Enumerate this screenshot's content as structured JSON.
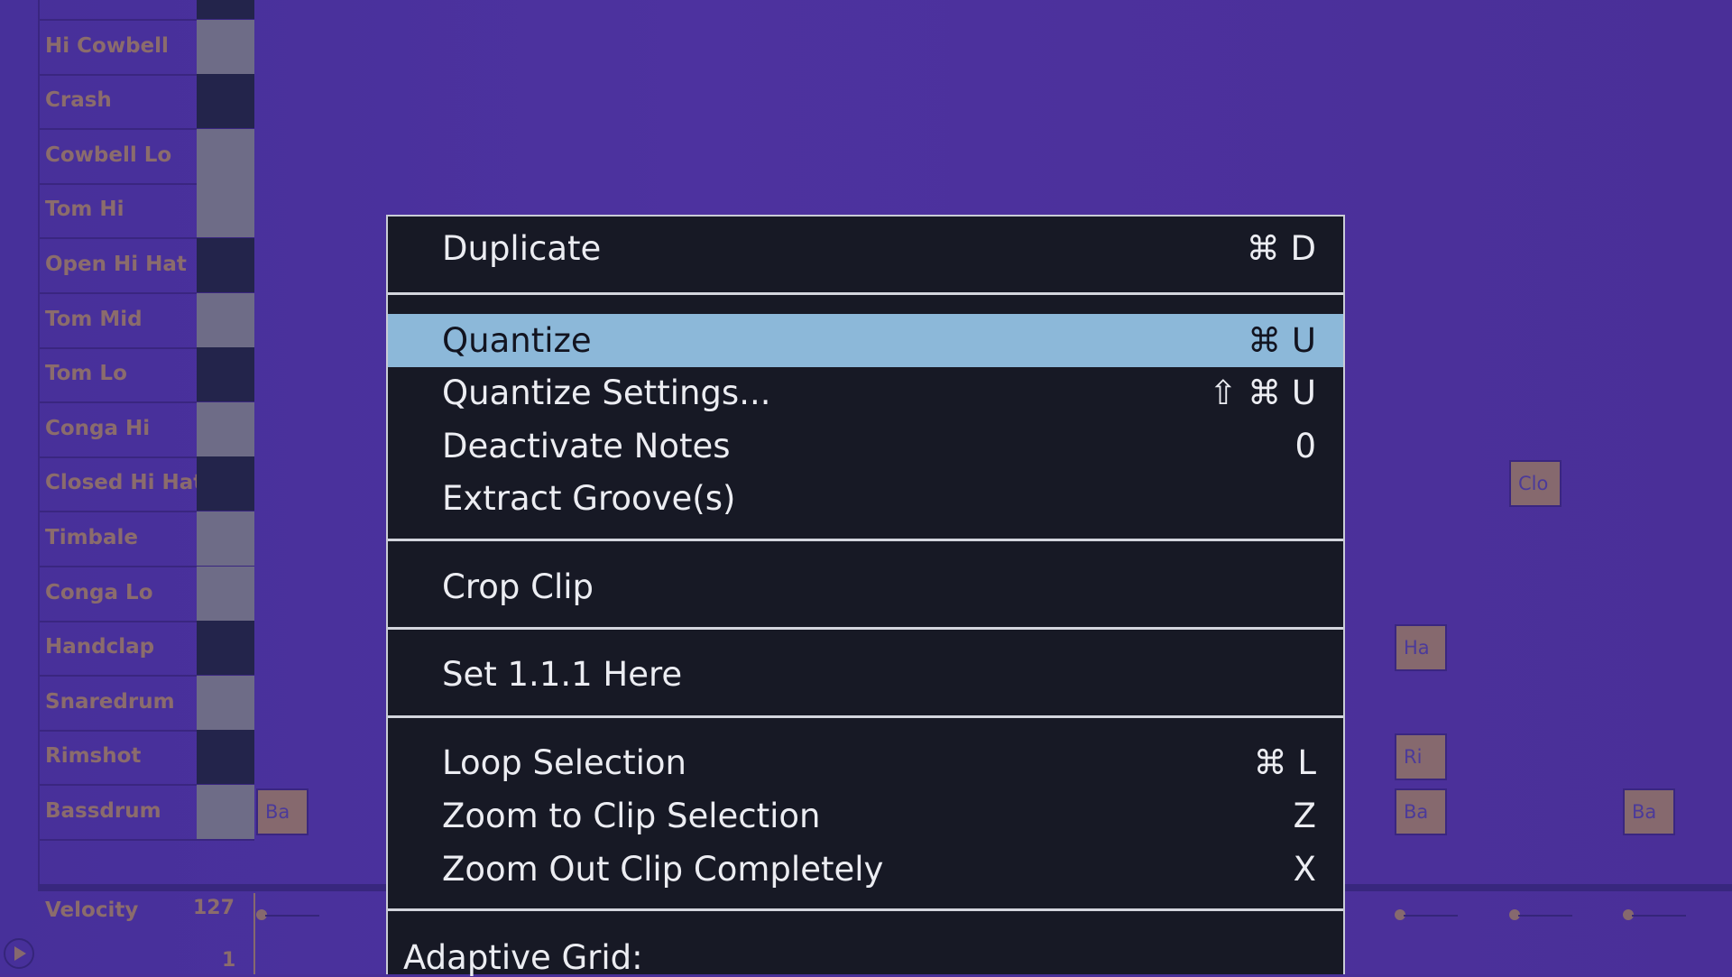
{
  "drum_rack": {
    "rows": [
      {
        "name": "",
        "key": "dark"
      },
      {
        "name": "Hi Cowbell",
        "key": "light"
      },
      {
        "name": "Crash",
        "key": "dark"
      },
      {
        "name": "Cowbell Lo",
        "key": "light"
      },
      {
        "name": "Tom Hi",
        "key": "light"
      },
      {
        "name": "Open Hi Hat",
        "key": "dark"
      },
      {
        "name": "Tom Mid",
        "key": "light"
      },
      {
        "name": "Tom Lo",
        "key": "dark"
      },
      {
        "name": "Conga Hi",
        "key": "light"
      },
      {
        "name": "Closed Hi Hat",
        "key": "dark"
      },
      {
        "name": "Timbale",
        "key": "light"
      },
      {
        "name": "Conga Lo",
        "key": "light"
      },
      {
        "name": "Handclap",
        "key": "dark"
      },
      {
        "name": "Snaredrum",
        "key": "light"
      },
      {
        "name": "Rimshot",
        "key": "dark"
      },
      {
        "name": "Bassdrum",
        "key": "light"
      }
    ],
    "notes": [
      {
        "label": "Ba",
        "row": 15,
        "step": 0
      },
      {
        "label": "Clo",
        "row": 9,
        "step": 3
      },
      {
        "label": "Ha",
        "row": 12,
        "step": 2
      },
      {
        "label": "Ri",
        "row": 14,
        "step": 2
      },
      {
        "label": "Ba",
        "row": 15,
        "step": 2
      },
      {
        "label": "Ba",
        "row": 15,
        "step": 4
      }
    ],
    "velocity": {
      "label": "Velocity",
      "max": "127",
      "min": "1"
    }
  },
  "context_menu": {
    "items": [
      {
        "label": "Duplicate",
        "shortcut": "⌘ D"
      },
      {
        "label": "Quantize",
        "shortcut": "⌘ U",
        "highlighted": true
      },
      {
        "label": "Quantize Settings...",
        "shortcut": "⇧ ⌘ U"
      },
      {
        "label": "Deactivate Notes",
        "shortcut": "0"
      },
      {
        "label": "Extract Groove(s)",
        "shortcut": ""
      },
      {
        "label": "Crop Clip",
        "shortcut": ""
      },
      {
        "label": "Set 1.1.1 Here",
        "shortcut": ""
      },
      {
        "label": "Loop Selection",
        "shortcut": "⌘ L"
      },
      {
        "label": "Zoom to Clip Selection",
        "shortcut": "Z"
      },
      {
        "label": "Zoom Out Clip Completely",
        "shortcut": "X"
      }
    ],
    "section_heading": "Adaptive Grid:"
  },
  "colors": {
    "background": "#4a2f98",
    "menu": "#171925",
    "highlight": "#8cb8d9"
  }
}
